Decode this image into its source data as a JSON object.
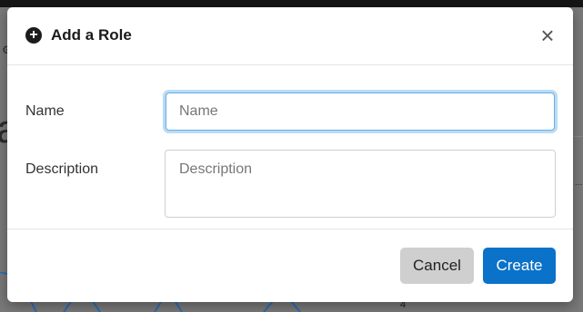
{
  "background": {
    "partial_heading_letter": "a",
    "axis_number": "4",
    "ellipsis": "..."
  },
  "modal": {
    "title": "Add a Role",
    "header_icon": "plus-circle-icon",
    "close_glyph": "×",
    "fields": {
      "name": {
        "label": "Name",
        "value": "",
        "placeholder": "Name"
      },
      "description": {
        "label": "Description",
        "value": "",
        "placeholder": "Description"
      }
    },
    "buttons": {
      "cancel": "Cancel",
      "create": "Create"
    }
  },
  "colors": {
    "primary": "#0a72c8",
    "focus_ring": "#66afe9",
    "cancel_bg": "#cfcfcf"
  }
}
